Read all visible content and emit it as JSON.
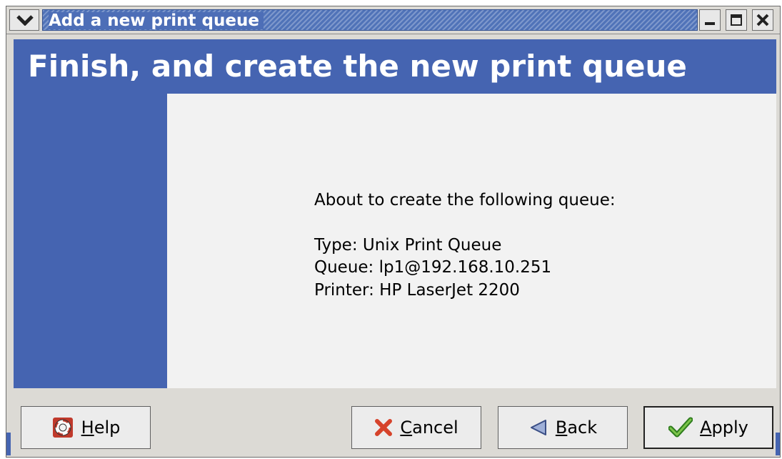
{
  "window": {
    "title": "Add a new print queue"
  },
  "header": {
    "title": "Finish, and create the new print queue"
  },
  "content": {
    "intro": "About to create the following queue:",
    "type_line": "Type: Unix Print Queue",
    "queue_line": "Queue: lp1@192.168.10.251",
    "printer_line": "Printer: HP LaserJet 2200"
  },
  "buttons": {
    "help": {
      "mnemonic": "H",
      "rest": "elp",
      "icon": "lifebuoy-icon"
    },
    "cancel": {
      "mnemonic": "C",
      "rest": "ancel",
      "icon": "red-x-icon"
    },
    "back": {
      "mnemonic": "B",
      "rest": "ack",
      "icon": "left-arrow-icon"
    },
    "apply": {
      "mnemonic": "A",
      "rest": "pply",
      "icon": "checkmark-icon"
    }
  },
  "colors": {
    "accent": "#4564b1",
    "content_bg": "#f2f2f2",
    "chrome": "#dcdad5"
  }
}
